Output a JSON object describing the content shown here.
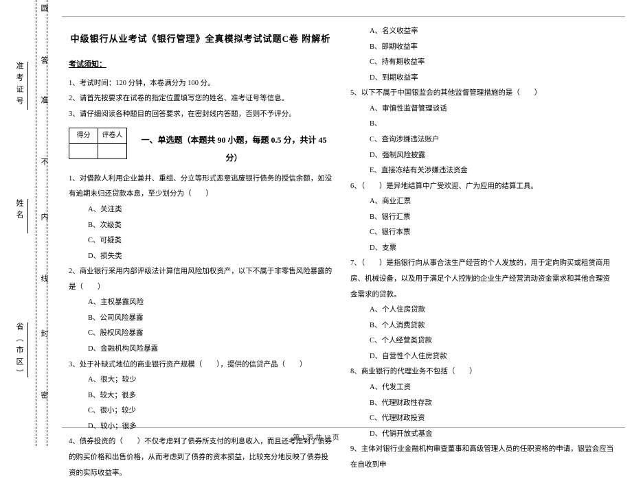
{
  "vertical": {
    "marks": [
      "圆",
      "答",
      "准",
      "不",
      "内",
      "线",
      "封",
      "密"
    ],
    "fields": [
      "准考证号",
      "姓名",
      "省（市区）"
    ]
  },
  "title": "中级银行从业考试《银行管理》全真模拟考试试题C卷 附解析",
  "notice_head": "考试须知：",
  "notices": [
    "1、考试时间：120 分钟，本卷满分为 100 分。",
    "2、请首先按要求在试卷的指定位置填写您的姓名、准考证号等信息。",
    "3、请仔细阅读各种题目的回答要求，在密封线内答题，否则不予评分。"
  ],
  "score_labels": {
    "left": "得分",
    "right": "评卷人"
  },
  "section_title": "一、单选题（本题共 90 小题，每题 0.5 分，共计 45 分）",
  "left_qs": {
    "q1": "1、对借款人利用企业兼并、重组、分立等形式恶意逃废银行债务的授信余额，如没有逾期未归还贷款本息，至少划分为（　　）",
    "q1_opts": [
      "A、关注类",
      "B、次级类",
      "C、可疑类",
      "D、损失类"
    ],
    "q2": "2、商业银行采用内部评级法计算信用风险加权资产，以下不属于非零售风险暴露的是（　　）",
    "q2_opts": [
      "A、主权暴露风险",
      "B、公司风险暴露",
      "C、股权风险暴露",
      "D、金融机构风险暴露"
    ],
    "q3": "3、处于补缺式地位的商业银行资产规模（　　），提供的信贷产品（　　）",
    "q3_opts": [
      "A、很大；较少",
      "B、较大；很多",
      "C、很小；较少",
      "D、较小；很多"
    ],
    "q4": "4、债券投资的（　　）不仅考虑到了债券所支付的利息收入，而且还考虑到了债券的购买价格和出售价格，从而考虑到了债券的资本损益，比较充分地反映了债券投资的实际收益率。"
  },
  "right_qs": {
    "q4_opts": [
      "A、名义收益率",
      "B、即期收益率",
      "C、持有期收益率",
      "D、到期收益率"
    ],
    "q5": "5、以下不属于中国银监会的其他监督管理措施的是（　　）",
    "q5_opts": [
      "A、审慎性监督管理谈话",
      "B",
      "C、查询涉嫌违法账户",
      "D、强制风险披露",
      "E、直接冻结有关涉嫌违法资金"
    ],
    "q5_optB": "B、",
    "q6": "6、（　　）是异地结算中广受欢迎、广为应用的结算工具。",
    "q6_opts": [
      "A、商业汇票",
      "B、银行汇票",
      "C、银行本票",
      "D、支票"
    ],
    "q7": "7、（　　）是指银行向从事合法生产经营的个人发放的，用于定向购买或租赁商用房、机械设备，以及用于满足个人控制的企业生产经营流动资金需求和其他合理资金需求的贷款。",
    "q7_opts": [
      "A、个人住房贷款",
      "B、个人消费贷款",
      "C、个人经营类贷款",
      "D、自营性个人住房贷款"
    ],
    "q8": "8、商业银行的代理业务不包括（　　）",
    "q8_opts": [
      "A、代发工资",
      "B、代理财政性存款",
      "C、代理财政投资",
      "D、代销开放式基金"
    ],
    "q9": "9、主体对银行业金融机构审查董事和高级管理人员的任职资格的申请，银监会应当在自收到申"
  },
  "footer": "第 1 页 共 18 页"
}
